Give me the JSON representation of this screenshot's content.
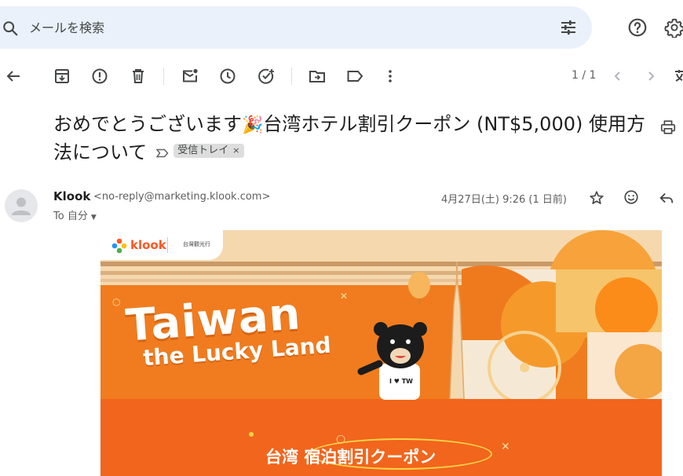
{
  "search": {
    "placeholder": "メールを検索"
  },
  "toolbar": {
    "page_count": "1 / 1",
    "icons": [
      "back-arrow-icon",
      "archive-icon",
      "report-spam-icon",
      "delete-icon",
      "mark-unread-icon",
      "snooze-icon",
      "add-task-icon",
      "move-to-icon",
      "label-icon",
      "more-vert-icon",
      "prev-icon",
      "next-icon"
    ]
  },
  "email": {
    "subject_part1": "おめでとうございます",
    "subject_emoji": "🎉",
    "subject_part2": "台湾ホテル割引クーポン (NT$5,000) 使用方法について",
    "label": "受信トレイ",
    "label_close": "×",
    "sender_name": "Klook",
    "sender_email": "<no-reply@marketing.klook.com>",
    "to_line": "To 自分",
    "date": "4月27日(土) 9:26 (1 日前)"
  },
  "banner": {
    "brand": "klook",
    "brand_partner": "台灣觀光行",
    "title": "Taiwan",
    "subtitle": "the Lucky Land",
    "coupon": "台湾  宿泊割引クーポン",
    "shirt_text": "I ♥ TW"
  },
  "colors": {
    "search_bg": "#eaf1fb",
    "banner_orange": "#ef7a1e",
    "banner_deep": "#f2651c",
    "brand_orange": "#ff5722"
  }
}
